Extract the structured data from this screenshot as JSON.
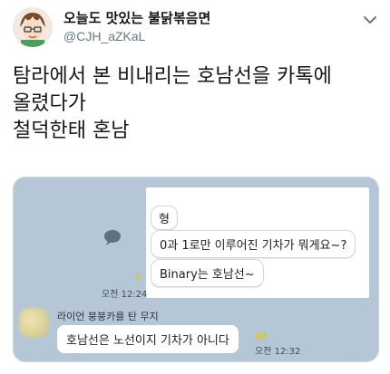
{
  "tweet": {
    "display_name": "오늘도 맛있는 불닭볶음면",
    "handle": "@CJH_aZKaL",
    "caret_icon": "chevron-down-icon",
    "text_lines": [
      "탐라에서 본 비내리는 호남선을 카톡에",
      "올렸다가",
      "철덕한태 혼남"
    ]
  },
  "chat": {
    "quote": {
      "sender": "형",
      "question": "0과 1로만 이루어진 기차가 뭐게요~?",
      "answer": "Binary는 호남선~"
    },
    "unread_1": "7",
    "time_1": "오전 12:24",
    "reply": {
      "sender_name": "라이언 붕붕카를 탄 무지",
      "message": "호남선은 노선이지 기차가 아니다",
      "unread": "10",
      "time": "오전 12:32"
    }
  },
  "colors": {
    "chat_background": "#b5c7d6",
    "unread_yellow": "#e8c400",
    "handle_gray": "#657786"
  }
}
